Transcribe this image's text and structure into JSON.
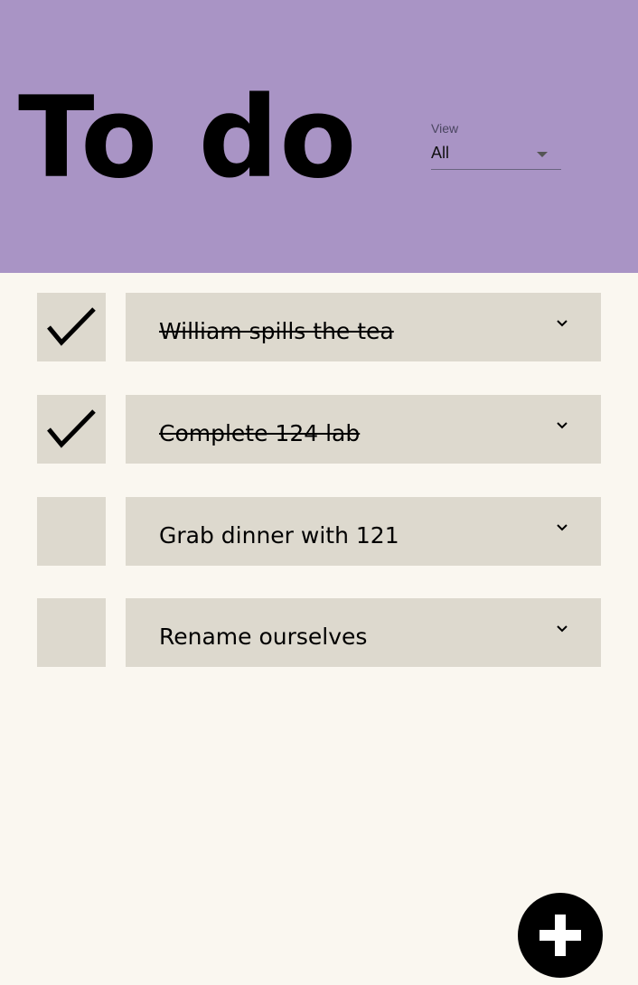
{
  "header": {
    "title": "To do",
    "background_color": "#a994c5"
  },
  "view_filter": {
    "label": "View",
    "value": "All",
    "icon": "dropdown-caret-icon"
  },
  "tasks": [
    {
      "text": "William spills the tea",
      "completed": true,
      "check_icon": "checkmark-icon",
      "expand_icon": "chevron-down-icon"
    },
    {
      "text": "Complete 124 lab",
      "completed": true,
      "check_icon": "checkmark-icon",
      "expand_icon": "chevron-down-icon"
    },
    {
      "text": "Grab dinner with 121",
      "completed": false,
      "check_icon": "",
      "expand_icon": "chevron-down-icon"
    },
    {
      "text": "Rename ourselves",
      "completed": false,
      "check_icon": "",
      "expand_icon": "chevron-down-icon"
    }
  ],
  "add_button": {
    "icon": "plus-icon"
  },
  "colors": {
    "page_background": "#faf7f0",
    "card_background": "#ddd9ce",
    "fab_background": "#000000"
  }
}
